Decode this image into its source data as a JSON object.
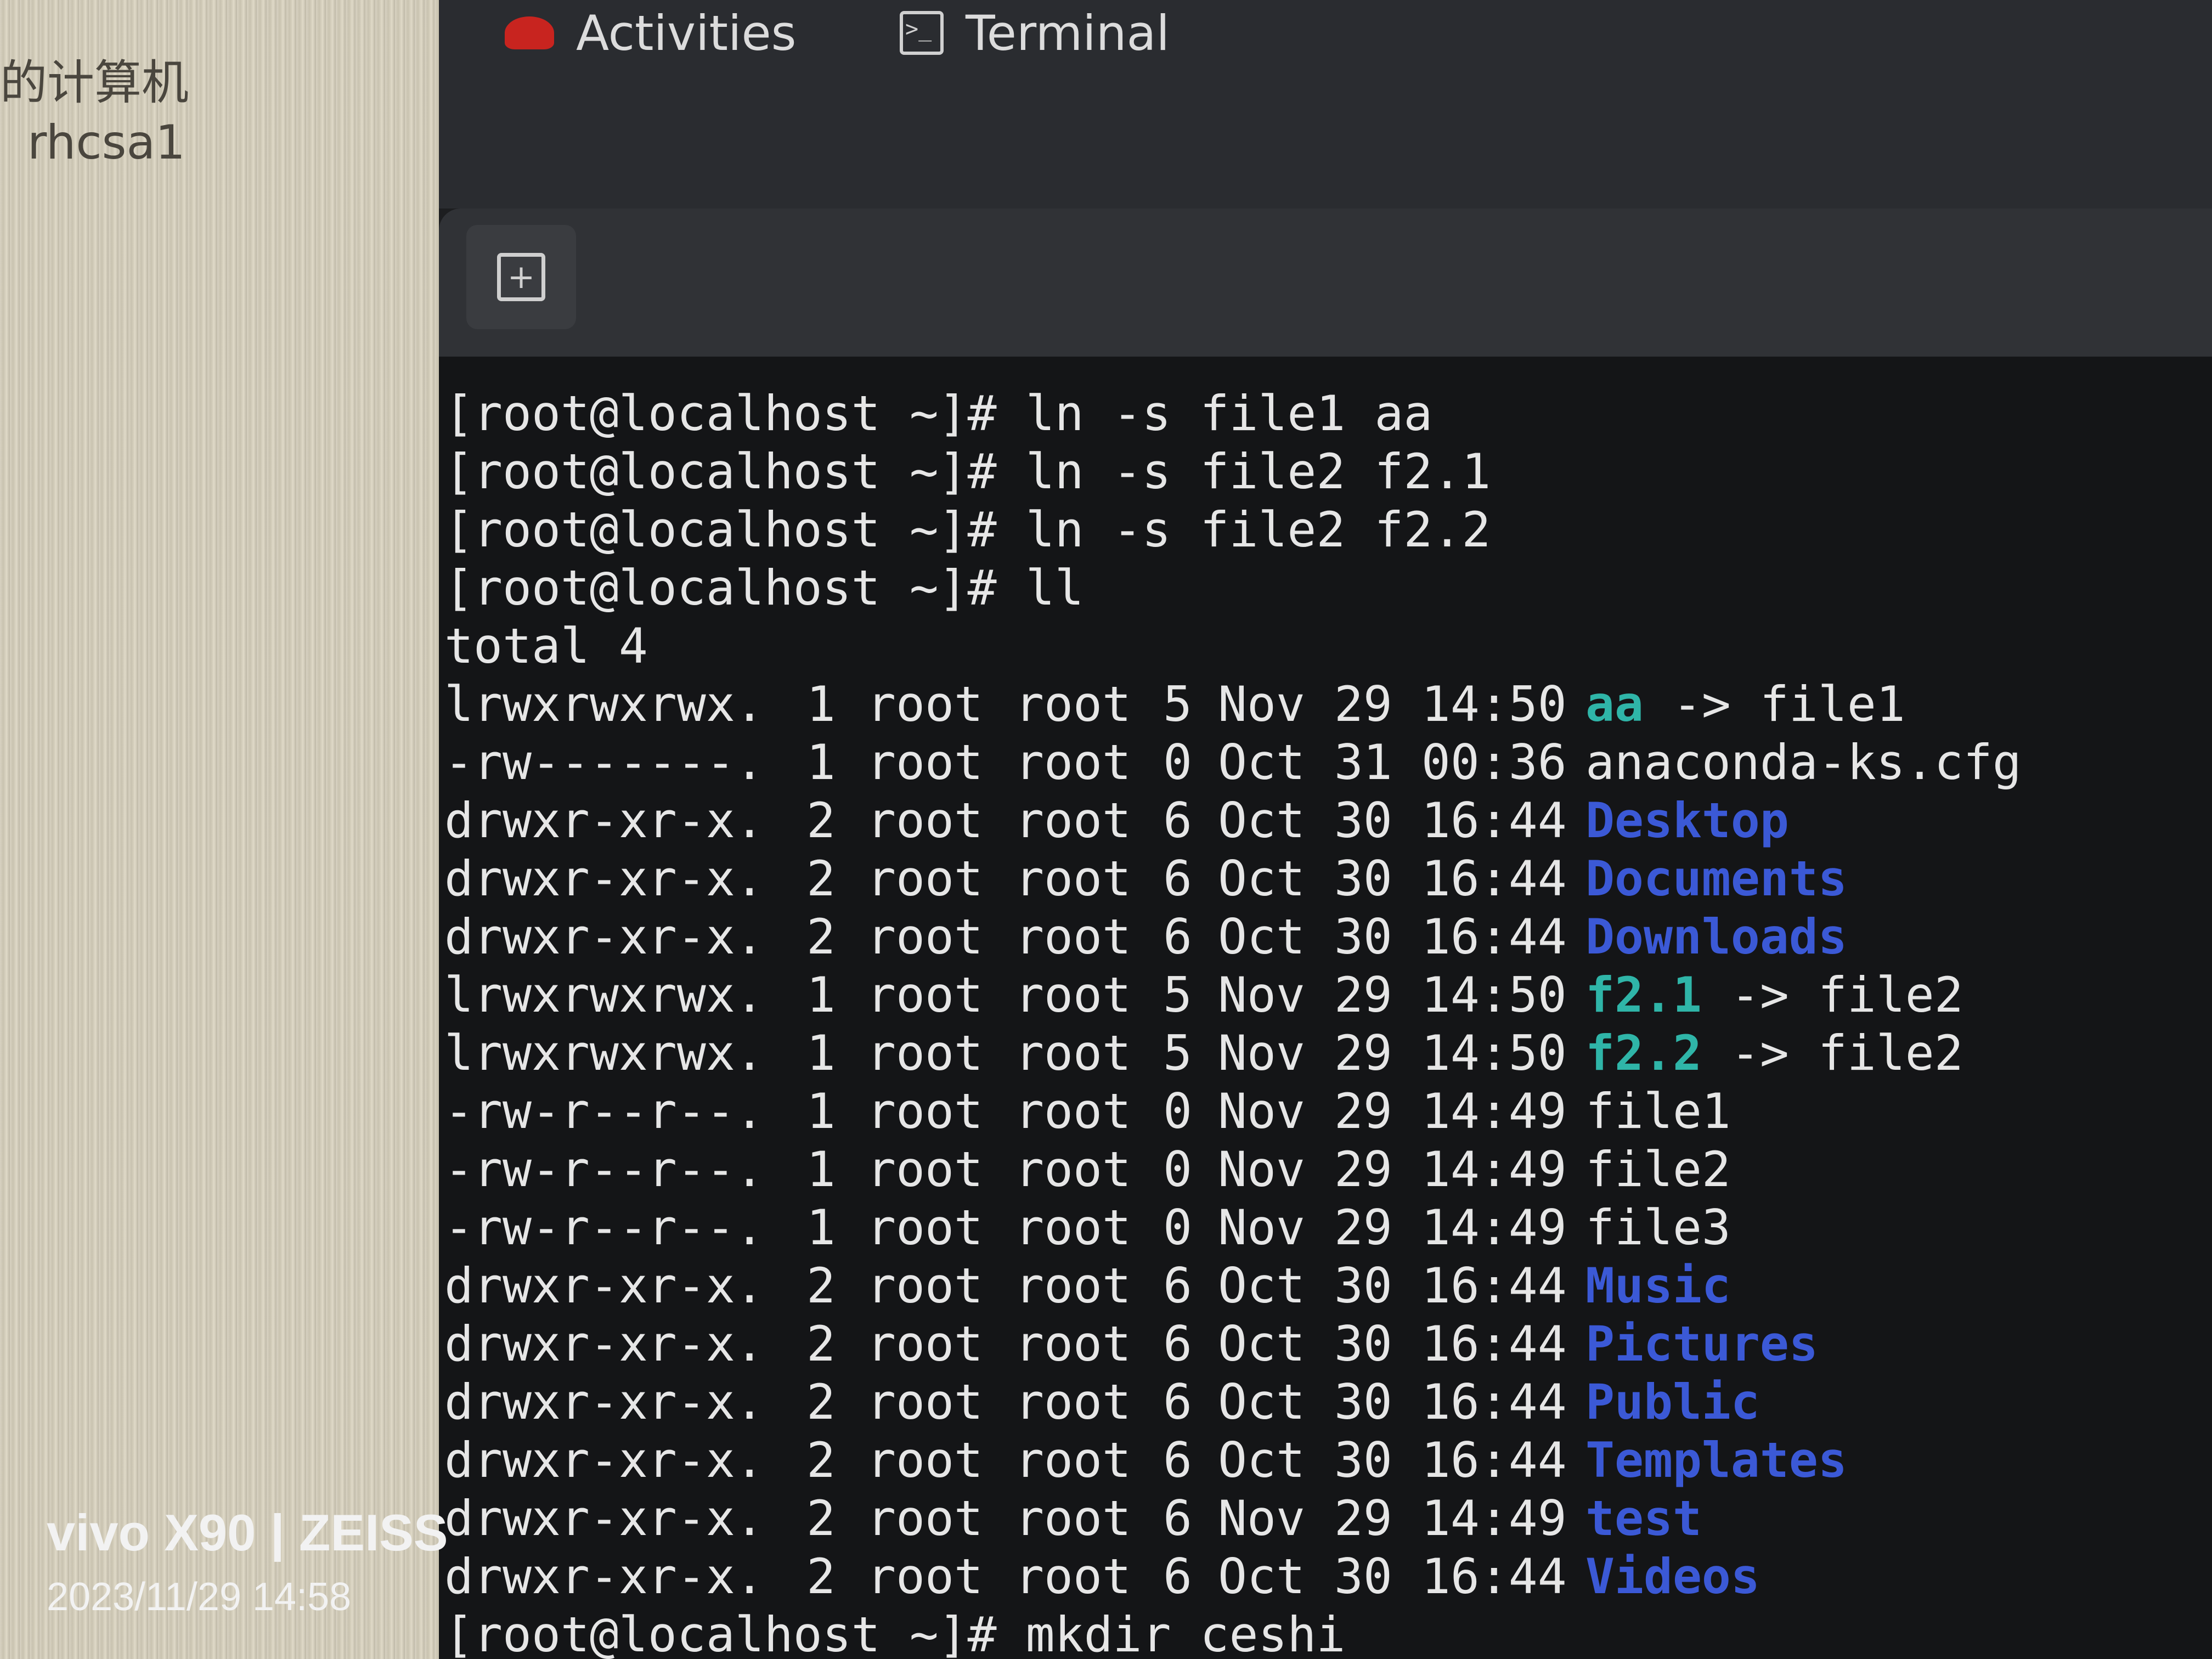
{
  "left_panel": {
    "computer_label": "的计算机",
    "vm_name": "rhcsa1"
  },
  "topbar": {
    "activities_label": "Activities",
    "terminal_label": "Terminal"
  },
  "terminal": {
    "commands": [
      {
        "prompt": "[root@localhost ~]# ",
        "cmd": "ln -s file1 aa"
      },
      {
        "prompt": "[root@localhost ~]# ",
        "cmd": "ln -s file2 f2.1"
      },
      {
        "prompt": "[root@localhost ~]# ",
        "cmd": "ln -s file2 f2.2"
      },
      {
        "prompt": "[root@localhost ~]# ",
        "cmd": "ll"
      }
    ],
    "total_line": "total 4",
    "listing": [
      {
        "perms": "lrwxrwxrwx.",
        "links": "1",
        "owner": "root",
        "group": "root",
        "size": "5",
        "date": "Nov 29 14:50",
        "name": "aa",
        "target": " -> file1",
        "kind": "link"
      },
      {
        "perms": "-rw-------.",
        "links": "1",
        "owner": "root",
        "group": "root",
        "size": "0",
        "date": "Oct 31 00:36",
        "name": "anaconda-ks.cfg",
        "target": "",
        "kind": "file"
      },
      {
        "perms": "drwxr-xr-x.",
        "links": "2",
        "owner": "root",
        "group": "root",
        "size": "6",
        "date": "Oct 30 16:44",
        "name": "Desktop",
        "target": "",
        "kind": "dir"
      },
      {
        "perms": "drwxr-xr-x.",
        "links": "2",
        "owner": "root",
        "group": "root",
        "size": "6",
        "date": "Oct 30 16:44",
        "name": "Documents",
        "target": "",
        "kind": "dir"
      },
      {
        "perms": "drwxr-xr-x.",
        "links": "2",
        "owner": "root",
        "group": "root",
        "size": "6",
        "date": "Oct 30 16:44",
        "name": "Downloads",
        "target": "",
        "kind": "dir"
      },
      {
        "perms": "lrwxrwxrwx.",
        "links": "1",
        "owner": "root",
        "group": "root",
        "size": "5",
        "date": "Nov 29 14:50",
        "name": "f2.1",
        "target": " -> file2",
        "kind": "link"
      },
      {
        "perms": "lrwxrwxrwx.",
        "links": "1",
        "owner": "root",
        "group": "root",
        "size": "5",
        "date": "Nov 29 14:50",
        "name": "f2.2",
        "target": " -> file2",
        "kind": "link"
      },
      {
        "perms": "-rw-r--r--.",
        "links": "1",
        "owner": "root",
        "group": "root",
        "size": "0",
        "date": "Nov 29 14:49",
        "name": "file1",
        "target": "",
        "kind": "file"
      },
      {
        "perms": "-rw-r--r--.",
        "links": "1",
        "owner": "root",
        "group": "root",
        "size": "0",
        "date": "Nov 29 14:49",
        "name": "file2",
        "target": "",
        "kind": "file"
      },
      {
        "perms": "-rw-r--r--.",
        "links": "1",
        "owner": "root",
        "group": "root",
        "size": "0",
        "date": "Nov 29 14:49",
        "name": "file3",
        "target": "",
        "kind": "file"
      },
      {
        "perms": "drwxr-xr-x.",
        "links": "2",
        "owner": "root",
        "group": "root",
        "size": "6",
        "date": "Oct 30 16:44",
        "name": "Music",
        "target": "",
        "kind": "dir"
      },
      {
        "perms": "drwxr-xr-x.",
        "links": "2",
        "owner": "root",
        "group": "root",
        "size": "6",
        "date": "Oct 30 16:44",
        "name": "Pictures",
        "target": "",
        "kind": "dir"
      },
      {
        "perms": "drwxr-xr-x.",
        "links": "2",
        "owner": "root",
        "group": "root",
        "size": "6",
        "date": "Oct 30 16:44",
        "name": "Public",
        "target": "",
        "kind": "dir"
      },
      {
        "perms": "drwxr-xr-x.",
        "links": "2",
        "owner": "root",
        "group": "root",
        "size": "6",
        "date": "Oct 30 16:44",
        "name": "Templates",
        "target": "",
        "kind": "dir"
      },
      {
        "perms": "drwxr-xr-x.",
        "links": "2",
        "owner": "root",
        "group": "root",
        "size": "6",
        "date": "Nov 29 14:49",
        "name": "test",
        "target": "",
        "kind": "dir"
      },
      {
        "perms": "drwxr-xr-x.",
        "links": "2",
        "owner": "root",
        "group": "root",
        "size": "6",
        "date": "Oct 30 16:44",
        "name": "Videos",
        "target": "",
        "kind": "dir"
      }
    ],
    "last_command": {
      "prompt": "[root@localhost ~]# ",
      "cmd": "mkdir ceshi"
    }
  },
  "watermark": {
    "brand": "vivo X90 | ZEISS",
    "date": "2023/11/29 14:58"
  },
  "colors": {
    "directory": "#3b59d6",
    "symlink": "#2fb5a8",
    "text": "#e6e6e6",
    "terminal_bg": "#141517"
  },
  "icons": {
    "activities": "redhat-icon",
    "terminal": "terminal-icon",
    "new_tab": "new-tab-icon"
  }
}
